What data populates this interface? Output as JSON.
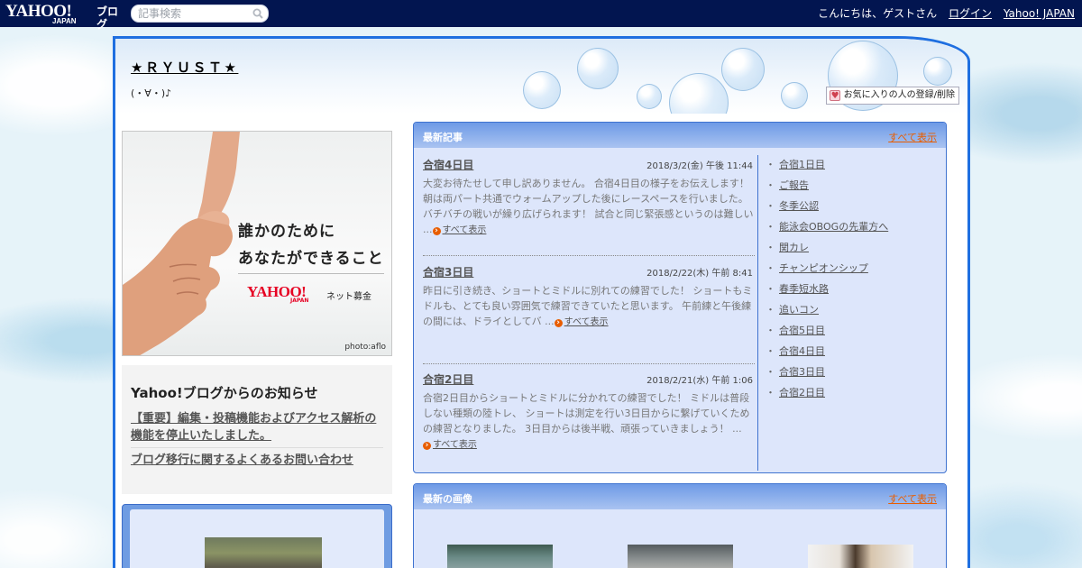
{
  "topbar": {
    "logo_yahoo": "YAHOO!",
    "logo_japan": "JAPAN",
    "logo_blog": "ブログ",
    "search_placeholder": "記事検索",
    "greeting": "こんにちは、ゲストさん",
    "login": "ログイン",
    "yahoo_japan": "Yahoo! JAPAN"
  },
  "header": {
    "title": "★ＲＹＵＳＴ★",
    "description": "(・∀・)♪",
    "favorite_button": "お気に入りの人の登録/削除"
  },
  "ad": {
    "line1": "誰かのために",
    "line2": "あなたができること",
    "logo_yahoo": "YAHOO!",
    "logo_japan": "JAPAN",
    "tagline": "ネット募金",
    "photo_credit": "photo:aflo"
  },
  "notice": {
    "heading": "Yahoo!ブログからのお知らせ",
    "links": [
      "【重要】編集・投稿機能およびアクセス解析の機能を停止いたしました。",
      "ブログ移行に関するよくあるお問い合わせ"
    ]
  },
  "recent_posts": {
    "title": "最新記事",
    "show_all": "すべて表示",
    "read_more": "すべて表示",
    "posts": [
      {
        "title": "合宿4日目",
        "date": "2018/3/2(金) 午後 11:44",
        "excerpt": "大変お待たせして申し訳ありません。 合宿4日目の様子をお伝えします！ 朝は両パート共通でウォームアップした後にレースペースを行いました。 バチバチの戦いが繰り広げられます！ 試合と同じ緊張感というのは難しい ..."
      },
      {
        "title": "合宿3日目",
        "date": "2018/2/22(木) 午前 8:41",
        "excerpt": "昨日に引き続き、ショートとミドルに別れての練習でした！ ショートもミドルも、とても良い雰囲気で練習できていたと思います。 午前練と午後練の間には、ドライとしてバ ..."
      },
      {
        "title": "合宿2日目",
        "date": "2018/2/21(水) 午前 1:06",
        "excerpt": "合宿2日目からショートとミドルに分かれての練習でした！ ミドルは普段しない種類の陸トレ、 ショートは測定を行い3日目からに繋げていくための練習となりました。 3日目からは後半戦、頑張っていきましょう！ ..."
      }
    ],
    "list": [
      "合宿1日目",
      "ご報告",
      "冬季公認",
      "能泳会OBOGの先輩方へ",
      "関カレ",
      "チャンピオンシップ",
      "春季短水路",
      "追いコン",
      "合宿5日目",
      "合宿4日目",
      "合宿3日目",
      "合宿2日目"
    ],
    "bullet": "・"
  },
  "recent_images": {
    "title": "最新の画像",
    "show_all": "すべて表示"
  },
  "colors": {
    "topbar": "#021550",
    "frame_border": "#1f6fe0",
    "panel_bg": "#dde6fb",
    "accent_link": "#e85d00"
  }
}
